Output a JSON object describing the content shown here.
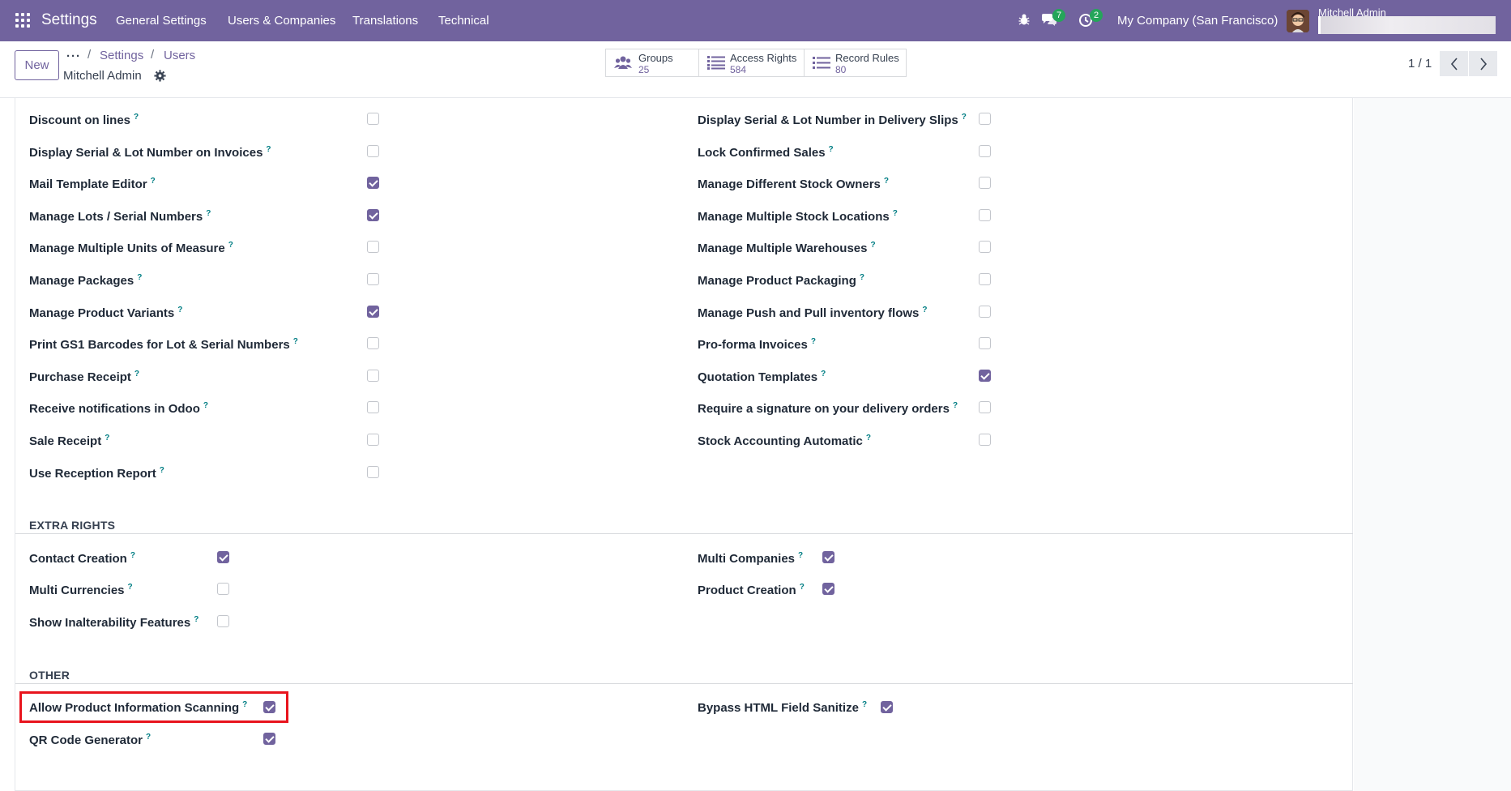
{
  "navbar": {
    "app_name": "Settings",
    "menu": [
      "General Settings",
      "Users & Companies",
      "Translations",
      "Technical"
    ],
    "chat_badge": "7",
    "activity_badge": "2",
    "company": "My Company (San Francisco)",
    "user_name": "Mitchell Admin",
    "accent_color": "#71639e"
  },
  "control": {
    "new_label": "New",
    "breadcrumb": [
      "Settings",
      "Users"
    ],
    "record_name": "Mitchell Admin",
    "smart_buttons": [
      {
        "label": "Groups",
        "value": "25",
        "icon": "users-icon"
      },
      {
        "label": "Access Rights",
        "value": "584",
        "icon": "list-icon"
      },
      {
        "label": "Record Rules",
        "value": "80",
        "icon": "list-icon"
      }
    ],
    "pager": "1 / 1"
  },
  "technical": {
    "left": [
      {
        "label": "Discount on lines",
        "checked": false
      },
      {
        "label": "Display Serial & Lot Number on Invoices",
        "checked": false
      },
      {
        "label": "Mail Template Editor",
        "checked": true
      },
      {
        "label": "Manage Lots / Serial Numbers",
        "checked": true
      },
      {
        "label": "Manage Multiple Units of Measure",
        "checked": false
      },
      {
        "label": "Manage Packages",
        "checked": false
      },
      {
        "label": "Manage Product Variants",
        "checked": true
      },
      {
        "label": "Print GS1 Barcodes for Lot & Serial Numbers",
        "checked": false
      },
      {
        "label": "Purchase Receipt",
        "checked": false
      },
      {
        "label": "Receive notifications in Odoo",
        "checked": false
      },
      {
        "label": "Sale Receipt",
        "checked": false
      },
      {
        "label": "Use Reception Report",
        "checked": false
      }
    ],
    "right": [
      {
        "label": "Display Serial & Lot Number in Delivery Slips",
        "checked": false
      },
      {
        "label": "Lock Confirmed Sales",
        "checked": false
      },
      {
        "label": "Manage Different Stock Owners",
        "checked": false
      },
      {
        "label": "Manage Multiple Stock Locations",
        "checked": false
      },
      {
        "label": "Manage Multiple Warehouses",
        "checked": false
      },
      {
        "label": "Manage Product Packaging",
        "checked": false
      },
      {
        "label": "Manage Push and Pull inventory flows",
        "checked": false
      },
      {
        "label": "Pro-forma Invoices",
        "checked": false
      },
      {
        "label": "Quotation Templates",
        "checked": true
      },
      {
        "label": "Require a signature on your delivery orders",
        "checked": false
      },
      {
        "label": "Stock Accounting Automatic",
        "checked": false
      }
    ]
  },
  "extra_rights": {
    "title": "EXTRA RIGHTS",
    "left": [
      {
        "label": "Contact Creation",
        "checked": true
      },
      {
        "label": "Multi Currencies",
        "checked": false
      },
      {
        "label": "Show Inalterability Features",
        "checked": false
      }
    ],
    "right": [
      {
        "label": "Multi Companies",
        "checked": true
      },
      {
        "label": "Product Creation",
        "checked": true
      }
    ]
  },
  "other": {
    "title": "OTHER",
    "left": [
      {
        "label": "Allow Product Information Scanning",
        "checked": true
      },
      {
        "label": "QR Code Generator",
        "checked": true
      }
    ],
    "right": [
      {
        "label": "Bypass HTML Field Sanitize",
        "checked": true
      }
    ]
  },
  "help_mark": "?"
}
